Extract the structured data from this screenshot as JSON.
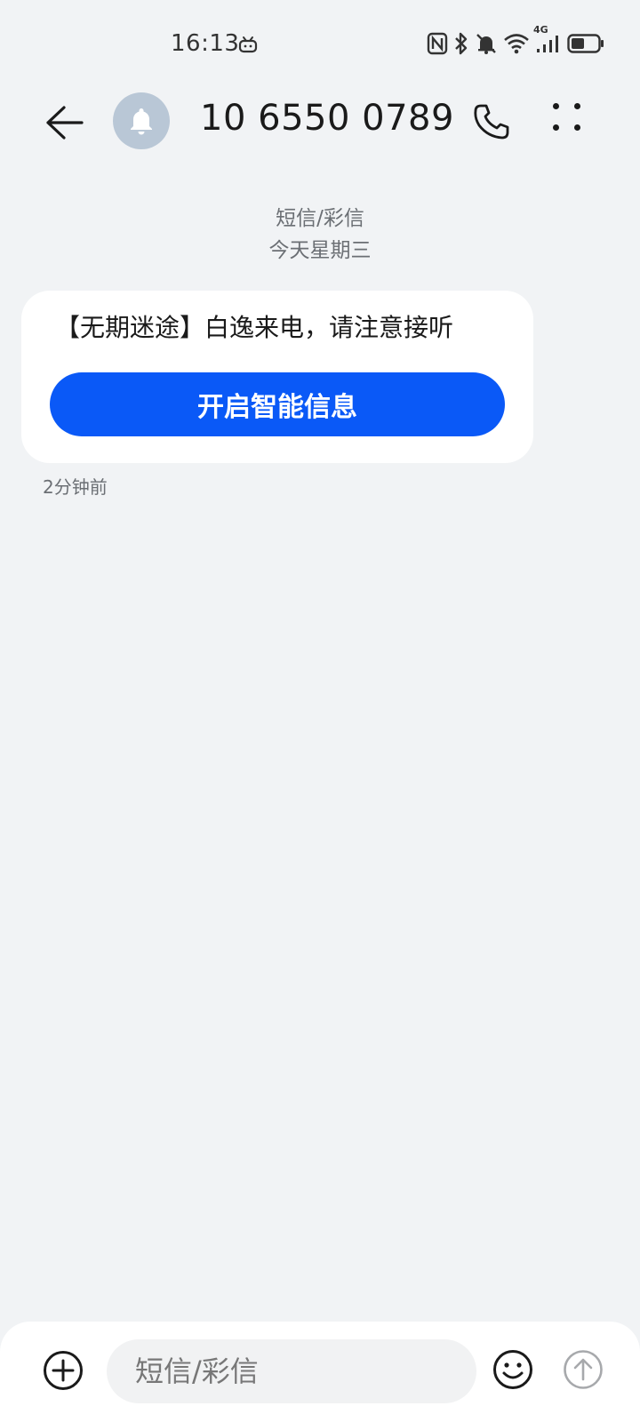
{
  "status_bar": {
    "time": "16:13",
    "icons": [
      "tv-icon",
      "nfc-icon",
      "bluetooth-icon",
      "mute-bell-icon",
      "wifi-icon",
      "signal-4g-icon",
      "battery-icon"
    ],
    "network_label": "4G"
  },
  "header": {
    "contact_name": "10 6550 0789",
    "avatar_icon": "bell-icon"
  },
  "conversation": {
    "type_label": "短信/彩信",
    "date_label": "今天星期三"
  },
  "message": {
    "text": "【无期迷途】白逸来电，请注意接听",
    "action_label": "开启智能信息",
    "time": "2分钟前"
  },
  "composer": {
    "placeholder": "短信/彩信"
  },
  "colors": {
    "background": "#f1f3f5",
    "accent": "#0a59f7",
    "avatar": "#b9c7d6"
  }
}
